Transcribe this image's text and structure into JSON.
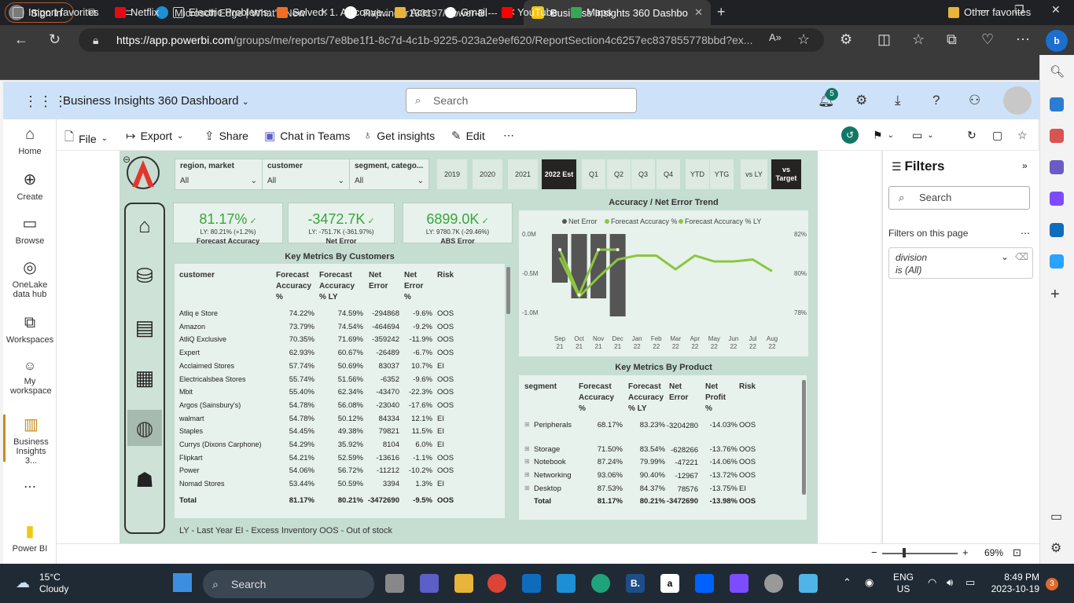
{
  "browser": {
    "signin": "Sign in",
    "tabs": [
      {
        "label": "Microsoft Edge | What's New"
      },
      {
        "label": "Rajwinder130197/Power-BI---Bu"
      },
      {
        "label": "Business Insights 360 Dashboard"
      }
    ],
    "url_host": "https://app.powerbi.com",
    "url_path": "/groups/me/reports/7e8be1f1-8c7d-4c1b-9225-023a2e9ef620/ReportSection4c6257ec837855778bbd?ex...",
    "favorites": [
      "Import favorites",
      "Netflix",
      "Electric Problems:",
      "Solved: 1. All conve...",
      "Acer",
      "Gmail",
      "YouTube",
      "Maps"
    ],
    "other_favorites": "Other favorites"
  },
  "pbi": {
    "title": "Business Insights 360 Dashboard",
    "search_placeholder": "Search",
    "notif_count": "5",
    "nav": [
      {
        "label": "Home",
        "icon": "home-icon"
      },
      {
        "label": "Create",
        "icon": "plus-circle-icon"
      },
      {
        "label": "Browse",
        "icon": "folder-icon"
      },
      {
        "label": "OneLake data hub",
        "icon": "onelake-icon"
      },
      {
        "label": "Workspaces",
        "icon": "workspaces-icon"
      },
      {
        "label": "My workspace",
        "icon": "person-icon"
      },
      {
        "label": "Business Insights 3...",
        "icon": "report-icon"
      },
      {
        "label": "Power BI",
        "icon": "powerbi-logo-icon"
      }
    ],
    "toolbar": {
      "file": "File",
      "export": "Export",
      "share": "Share",
      "chat": "Chat in Teams",
      "insights": "Get insights",
      "edit": "Edit"
    }
  },
  "report": {
    "slicers": [
      {
        "title": "region, market",
        "value": "All"
      },
      {
        "title": "customer",
        "value": "All"
      },
      {
        "title": "segment, catego...",
        "value": "All"
      }
    ],
    "years": [
      "2019",
      "2020",
      "2021",
      "2022 Est",
      "Q1",
      "Q2",
      "Q3",
      "Q4",
      "YTD",
      "YTG",
      "vs LY",
      "vs Target"
    ],
    "selected_year": "2022 Est",
    "kpis": [
      {
        "value": "81.17%",
        "ly": "LY: 80.21% (+1.2%)",
        "label": "Forecast Accuracy"
      },
      {
        "value": "-3472.7K",
        "ly": "LY: -751.7K (-361.97%)",
        "label": "Net Error"
      },
      {
        "value": "6899.0K",
        "ly": "LY: 9780.7K (-29.46%)",
        "label": "ABS Error"
      }
    ],
    "customers": {
      "title": "Key Metrics By Customers",
      "headers": [
        "customer",
        "Forecast Accuracy %",
        "Forecast Accuracy % LY",
        "Net Error",
        "Net Error %",
        "Risk"
      ],
      "rows": [
        [
          "Atliq e Store",
          "74.22%",
          "74.59%",
          "-294868",
          "-9.6%",
          "OOS"
        ],
        [
          "Amazon",
          "73.79%",
          "74.54%",
          "-464694",
          "-9.2%",
          "OOS"
        ],
        [
          "AtliQ Exclusive",
          "70.35%",
          "71.69%",
          "-359242",
          "-11.9%",
          "OOS"
        ],
        [
          "Expert",
          "62.93%",
          "60.67%",
          "-26489",
          "-6.7%",
          "OOS"
        ],
        [
          "Acclaimed Stores",
          "57.74%",
          "50.69%",
          "83037",
          "10.7%",
          "EI"
        ],
        [
          "Electricalsbea Stores",
          "55.74%",
          "51.56%",
          "-6352",
          "-9.6%",
          "OOS"
        ],
        [
          "Mbit",
          "55.40%",
          "62.34%",
          "-43470",
          "-22.3%",
          "OOS"
        ],
        [
          "Argos (Sainsbury's)",
          "54.78%",
          "56.08%",
          "-23040",
          "-17.6%",
          "OOS"
        ],
        [
          "walmart",
          "54.78%",
          "50.12%",
          "84334",
          "12.1%",
          "EI"
        ],
        [
          "Staples",
          "54.45%",
          "49.38%",
          "79821",
          "11.5%",
          "EI"
        ],
        [
          "Currys (Dixons Carphone)",
          "54.29%",
          "35.92%",
          "8104",
          "6.0%",
          "EI"
        ],
        [
          "Flipkart",
          "54.21%",
          "52.59%",
          "-13616",
          "-1.1%",
          "OOS"
        ],
        [
          "Power",
          "54.06%",
          "56.72%",
          "-11212",
          "-10.2%",
          "OOS"
        ],
        [
          "Nomad Stores",
          "53.44%",
          "50.59%",
          "3394",
          "1.3%",
          "EI"
        ]
      ],
      "total": [
        "Total",
        "81.17%",
        "80.21%",
        "-3472690",
        "-9.5%",
        "OOS"
      ]
    },
    "trend": {
      "title": "Accuracy / Net Error Trend",
      "legend": [
        "Net Error",
        "Forecast Accuracy %",
        "Forecast Accuracy % LY"
      ],
      "yleft": [
        "0.0M",
        "-0.5M",
        "-1.0M"
      ],
      "yright": [
        "82%",
        "80%",
        "78%"
      ]
    },
    "products": {
      "title": "Key Metrics By Product",
      "headers": [
        "segment",
        "Forecast Accuracy %",
        "Forecast Accuracy % LY",
        "Net Error",
        "Net Profit %",
        "Risk"
      ],
      "rows": [
        [
          "Peripherals",
          "68.17%",
          "83.23%",
          "-3204280",
          "-14.03%",
          "OOS"
        ],
        [
          "Storage",
          "71.50%",
          "83.54%",
          "-628266",
          "-13.76%",
          "OOS"
        ],
        [
          "Notebook",
          "87.24%",
          "79.99%",
          "-47221",
          "-14.06%",
          "OOS"
        ],
        [
          "Networking",
          "93.06%",
          "90.40%",
          "-12967",
          "-13.72%",
          "OOS"
        ],
        [
          "Desktop",
          "87.53%",
          "84.37%",
          "78576",
          "-13.75%",
          "EI"
        ]
      ],
      "total": [
        "Total",
        "81.17%",
        "80.21%",
        "-3472690",
        "-13.98%",
        "OOS"
      ]
    },
    "footer": "LY - Last Year   EI - Excess Inventory   OOS - Out of stock"
  },
  "chart_data": {
    "type": "bar",
    "title": "Accuracy / Net Error Trend",
    "categories": [
      "Sep 21",
      "Oct 21",
      "Nov 21",
      "Dec 21",
      "Jan 22",
      "Feb 22",
      "Mar 22",
      "Apr 22",
      "May 22",
      "Jun 22",
      "Jul 22",
      "Aug 22"
    ],
    "series": [
      {
        "name": "Net Error",
        "type": "bar",
        "values": [
          -0.62,
          -0.82,
          -0.82,
          -1.05,
          null,
          null,
          null,
          null,
          null,
          null,
          null,
          null
        ]
      },
      {
        "name": "Forecast Accuracy %",
        "type": "line",
        "values": [
          81.2,
          78.9,
          81.2,
          81.2,
          null,
          null,
          null,
          null,
          null,
          null,
          null,
          null
        ]
      },
      {
        "name": "Forecast Accuracy % LY",
        "type": "line",
        "values": [
          80.8,
          78.8,
          79.8,
          80.7,
          80.9,
          80.9,
          80.2,
          80.9,
          80.6,
          80.6,
          80.7,
          80.1
        ]
      }
    ],
    "ylim_left": [
      -1.0,
      0.0
    ],
    "ylim_right": [
      78,
      82
    ],
    "colors": {
      "bar": "#555555",
      "line": "#8dc63f"
    }
  },
  "filters": {
    "title": "Filters",
    "search_placeholder": "Search",
    "section": "Filters on this page",
    "card_field": "division",
    "card_value": "is (All)"
  },
  "status": {
    "zoom": "69%"
  },
  "taskbar": {
    "weather_temp": "15°C",
    "weather_desc": "Cloudy",
    "search": "Search",
    "lang1": "ENG",
    "lang2": "US",
    "time": "8:49 PM",
    "date": "2023-10-19",
    "badge": "3"
  }
}
